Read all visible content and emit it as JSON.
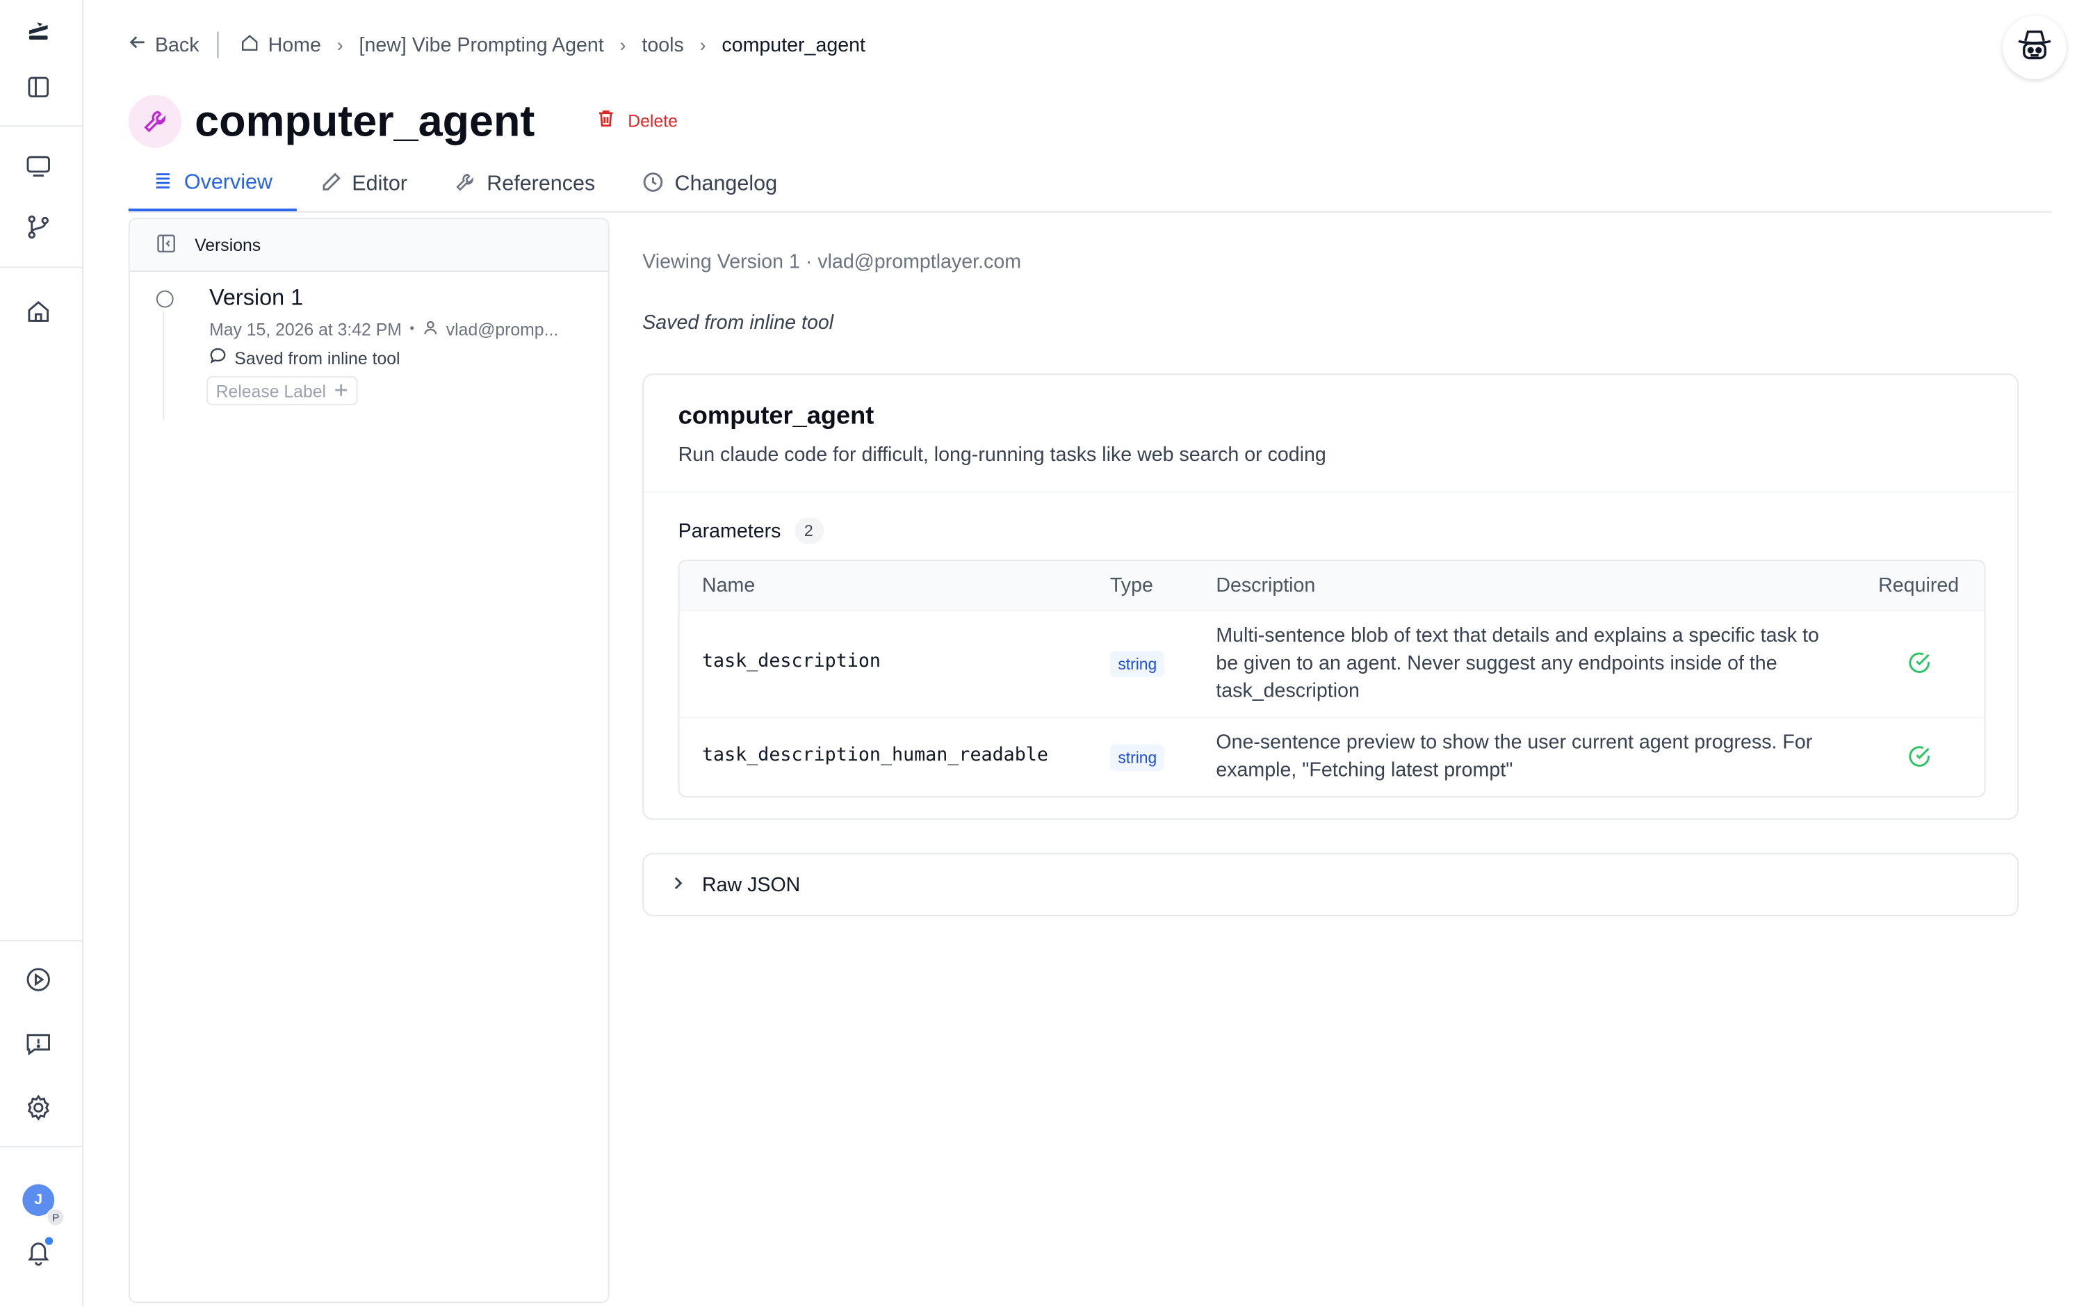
{
  "breadcrumb": {
    "back": "Back",
    "home": "Home",
    "workspace": "[new] Vibe Prompting Agent",
    "section": "tools",
    "current": "computer_agent"
  },
  "page": {
    "title": "computer_agent",
    "delete_label": "Delete"
  },
  "tabs": [
    {
      "label": "Overview",
      "icon": "list-icon",
      "active": true
    },
    {
      "label": "Editor",
      "icon": "pencil-icon",
      "active": false
    },
    {
      "label": "References",
      "icon": "wrench-icon",
      "active": false
    },
    {
      "label": "Changelog",
      "icon": "clock-icon",
      "active": false
    }
  ],
  "versions_panel": {
    "header": "Versions",
    "items": [
      {
        "name": "Version 1",
        "date": "May 15, 2026 at 3:42 PM",
        "author": "vlad@promp...",
        "note": "Saved from inline tool",
        "release_label": "Release Label"
      }
    ]
  },
  "main": {
    "viewing": "Viewing Version 1 · vlad@promptlayer.com",
    "saved_note": "Saved from inline tool",
    "tool": {
      "name": "computer_agent",
      "description": "Run claude code for difficult, long-running tasks like web search or coding"
    },
    "parameters": {
      "label": "Parameters",
      "count": "2",
      "columns": [
        "Name",
        "Type",
        "Description",
        "Required"
      ],
      "rows": [
        {
          "name": "task_description",
          "type": "string",
          "description": "Multi-sentence blob of text that details and explains a specific task to be given to an agent. Never suggest any endpoints inside of the task_description",
          "required": true
        },
        {
          "name": "task_description_human_readable",
          "type": "string",
          "description": "One-sentence preview to show the user current agent progress. For example, \"Fetching latest prompt\"",
          "required": true
        }
      ]
    },
    "raw_json_label": "Raw JSON"
  },
  "user": {
    "avatar_initial": "J",
    "avatar_sub": "P"
  },
  "colors": {
    "accent": "#2563eb",
    "danger": "#dc2626",
    "success": "#22c55e",
    "tool_icon": "#c026d3"
  }
}
